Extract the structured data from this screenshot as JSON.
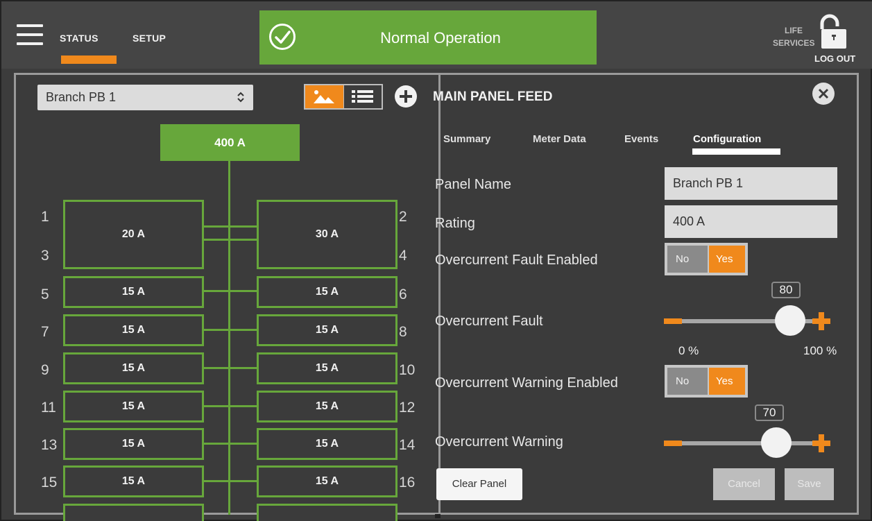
{
  "nav": {
    "status_label": "STATUS",
    "setup_label": "SETUP"
  },
  "status_banner": {
    "text": "Normal Operation",
    "color": "#67a73b"
  },
  "life_services": {
    "line1": "LIFE",
    "line2": "SERVICES"
  },
  "logout_label": "LOG OUT",
  "panel": {
    "selected": "Branch PB 1",
    "main_rating": "400 A",
    "left_breakers": [
      {
        "label": "20 A",
        "slots": [
          "1",
          "3"
        ]
      },
      {
        "label": "15 A",
        "slots": [
          "5"
        ]
      },
      {
        "label": "15 A",
        "slots": [
          "7"
        ]
      },
      {
        "label": "15 A",
        "slots": [
          "9"
        ]
      },
      {
        "label": "15 A",
        "slots": [
          "11"
        ]
      },
      {
        "label": "15 A",
        "slots": [
          "13"
        ]
      },
      {
        "label": "15 A",
        "slots": [
          "15"
        ]
      }
    ],
    "right_breakers": [
      {
        "label": "30 A",
        "slots": [
          "2",
          "4"
        ]
      },
      {
        "label": "15 A",
        "slots": [
          "6"
        ]
      },
      {
        "label": "15 A",
        "slots": [
          "8"
        ]
      },
      {
        "label": "15 A",
        "slots": [
          "10"
        ]
      },
      {
        "label": "15 A",
        "slots": [
          "12"
        ]
      },
      {
        "label": "15 A",
        "slots": [
          "14"
        ]
      },
      {
        "label": "15 A",
        "slots": [
          "16"
        ]
      }
    ]
  },
  "detail": {
    "title": "MAIN PANEL FEED",
    "tabs": [
      "Summary",
      "Meter Data",
      "Events",
      "Configuration"
    ],
    "active_tab": "Configuration",
    "fields": {
      "panel_name_label": "Panel Name",
      "panel_name_value": "Branch PB 1",
      "rating_label": "Rating",
      "rating_value": "400 A",
      "oc_fault_enabled_label": "Overcurrent Fault Enabled",
      "oc_fault_label": "Overcurrent Fault",
      "oc_warning_enabled_label": "Overcurrent Warning Enabled",
      "oc_warning_label": "Overcurrent Warning"
    },
    "toggle": {
      "no": "No",
      "yes": "Yes"
    },
    "oc_fault_value": "80",
    "oc_warning_value": "70",
    "range_min": "0 %",
    "range_max": "100 %",
    "buttons": {
      "clear": "Clear Panel",
      "cancel": "Cancel",
      "save": "Save"
    }
  },
  "colors": {
    "accent": "#f0891c",
    "breaker_green": "#67a73b",
    "background": "#3c3c3c"
  }
}
